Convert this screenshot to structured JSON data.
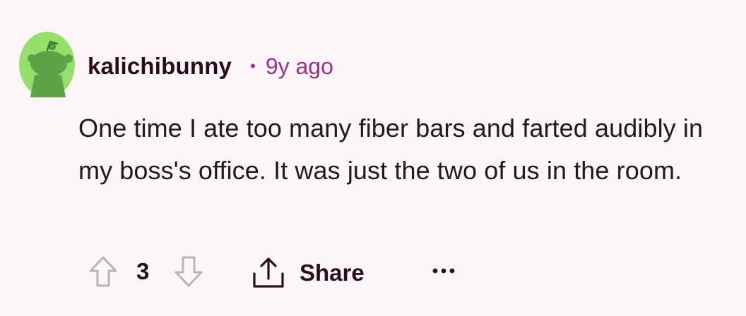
{
  "comment": {
    "username": "kalichibunny",
    "separator": "•",
    "time_ago": "9y ago",
    "body": "One time I ate too many fiber bars and farted audibly in my boss's office. It was just the two of us in the room."
  },
  "actions": {
    "score": "3",
    "share_label": "Share",
    "upvote_icon": "arrow-up-outline-icon",
    "downvote_icon": "arrow-down-outline-icon",
    "share_icon": "share-upload-icon",
    "more_icon": "ellipsis-icon"
  },
  "colors": {
    "background": "#fcf6f9",
    "username": "#2a0d1c",
    "timestamp": "#9e2f8a",
    "body_text": "#1f1a1d",
    "avatar_bg": "#94e06b",
    "avatar_figure": "#5aa347",
    "vote_icon": "#b8b3b6"
  }
}
